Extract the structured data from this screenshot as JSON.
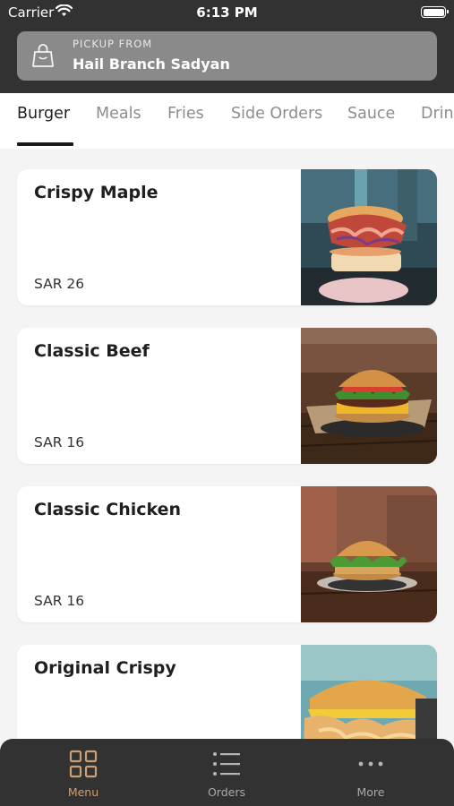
{
  "status_bar": {
    "carrier": "Carrier",
    "time": "6:13 PM"
  },
  "pickup": {
    "label": "PICKUP FROM",
    "branch": "Hail Branch Sadyan"
  },
  "categories": [
    {
      "label": "Burger",
      "active": true
    },
    {
      "label": "Meals"
    },
    {
      "label": "Fries"
    },
    {
      "label": "Side Orders"
    },
    {
      "label": "Sauce"
    },
    {
      "label": "Drinks"
    }
  ],
  "menu_items": [
    {
      "name": "Crispy Maple",
      "price": "SAR 26",
      "image": "burger-photo"
    },
    {
      "name": "Classic Beef",
      "price": "SAR 16",
      "image": "burger-photo"
    },
    {
      "name": "Classic Chicken",
      "price": "SAR 16",
      "image": "burger-photo"
    },
    {
      "name": "Original Crispy",
      "price": "",
      "image": "burger-photo"
    }
  ],
  "tabbar": [
    {
      "label": "Menu",
      "icon": "grid-icon",
      "active": true
    },
    {
      "label": "Orders",
      "icon": "list-icon"
    },
    {
      "label": "More",
      "icon": "more-icon"
    }
  ],
  "colors": {
    "header_bg": "#333232",
    "accent": "#c9a074",
    "pickup_bg": "#8a8a8a"
  }
}
